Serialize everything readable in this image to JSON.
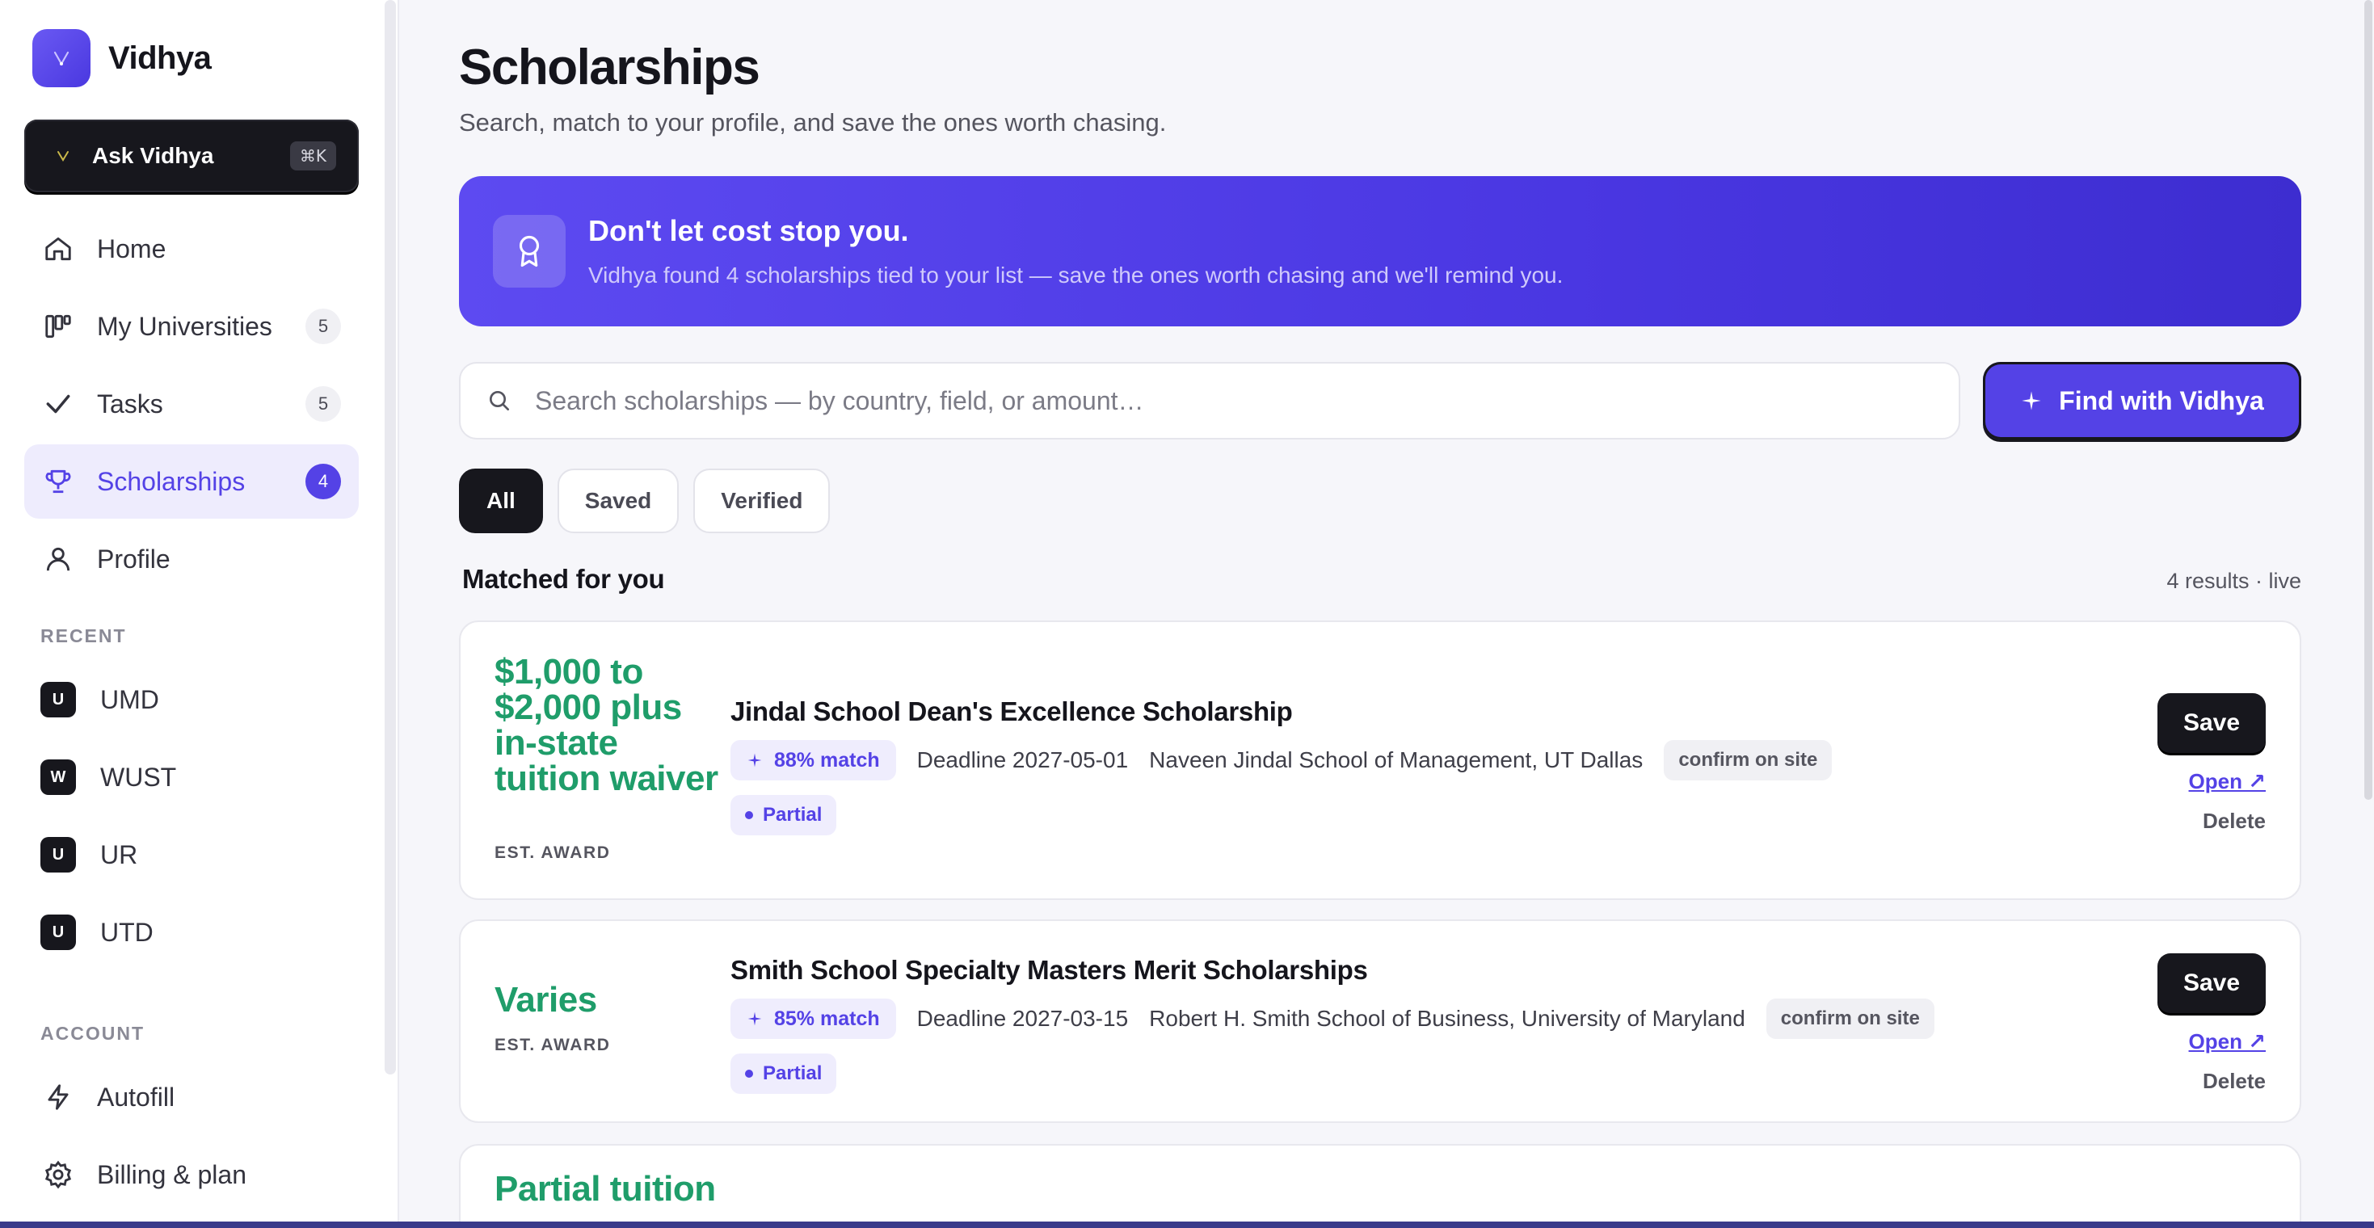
{
  "brand": {
    "name": "Vidhya"
  },
  "ask": {
    "label": "Ask Vidhya",
    "shortcut": "⌘K"
  },
  "nav": [
    {
      "label": "Home",
      "icon": "home-icon"
    },
    {
      "label": "My Universities",
      "icon": "columns-icon",
      "count": "5"
    },
    {
      "label": "Tasks",
      "icon": "check-icon",
      "count": "5"
    },
    {
      "label": "Scholarships",
      "icon": "trophy-icon",
      "count": "4",
      "active": true
    },
    {
      "label": "Profile",
      "icon": "user-icon"
    }
  ],
  "recent": {
    "title": "RECENT",
    "items": [
      {
        "badge": "U",
        "label": "UMD"
      },
      {
        "badge": "W",
        "label": "WUST"
      },
      {
        "badge": "U",
        "label": "UR"
      },
      {
        "badge": "U",
        "label": "UTD"
      }
    ]
  },
  "account": {
    "title": "ACCOUNT",
    "items": [
      {
        "label": "Autofill",
        "icon": "bolt-icon"
      },
      {
        "label": "Billing & plan",
        "icon": "gear-icon"
      }
    ]
  },
  "page": {
    "title": "Scholarships",
    "subtitle": "Search, match to your profile, and save the ones worth chasing."
  },
  "banner": {
    "title": "Don't let cost stop you.",
    "text": "Vidhya found 4 scholarships tied to your list — save the ones worth chasing and we'll remind you."
  },
  "search": {
    "placeholder": "Search scholarships — by country, field, or amount…",
    "value": ""
  },
  "find_button": {
    "label": "Find with Vidhya"
  },
  "filters": [
    {
      "label": "All",
      "active": true
    },
    {
      "label": "Saved"
    },
    {
      "label": "Verified"
    }
  ],
  "list": {
    "heading": "Matched for you",
    "count": "4 results · live"
  },
  "scholarships": [
    {
      "award": "$1,000 to $2,000 plus in-state tuition waiver",
      "award_label": "EST. AWARD",
      "title": "Jindal School Dean's Excellence Scholarship",
      "match": "88% match",
      "deadline": "Deadline 2027-05-01",
      "institution": "Naveen Jindal School of Management, UT Dallas",
      "confirm": "confirm on site",
      "tag": "Partial",
      "save": "Save",
      "open": "Open ↗",
      "delete": "Delete"
    },
    {
      "award": "Varies",
      "award_label": "EST. AWARD",
      "title": "Smith School Specialty Masters Merit Scholarships",
      "match": "85% match",
      "deadline": "Deadline 2027-03-15",
      "institution": "Robert H. Smith School of Business, University of Maryland",
      "confirm": "confirm on site",
      "tag": "Partial",
      "save": "Save",
      "open": "Open ↗",
      "delete": "Delete"
    },
    {
      "award": "Partial tuition"
    }
  ],
  "colors": {
    "accent": "#5442e6",
    "award_green": "#1f9d6a",
    "dark": "#17171d"
  }
}
